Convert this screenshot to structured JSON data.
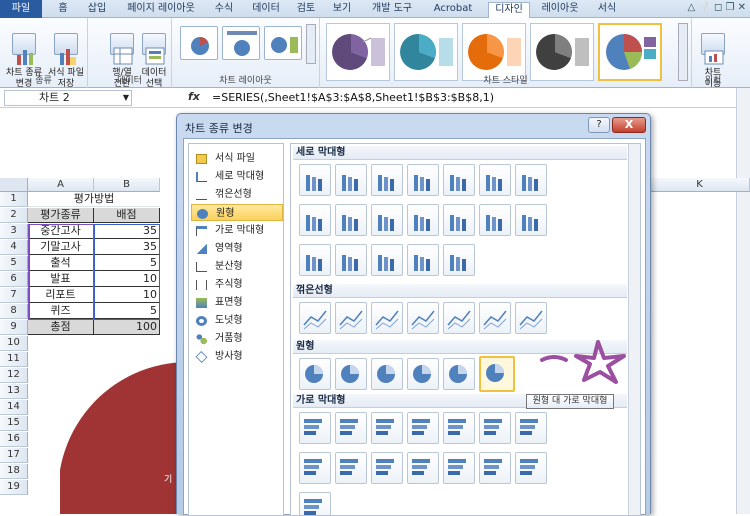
{
  "ribbon": {
    "tabs": [
      "파일",
      "홈",
      "삽입",
      "페이지 레이아웃",
      "수식",
      "데이터",
      "검토",
      "보기",
      "개발 도구",
      "Acrobat",
      "디자인",
      "레이아웃",
      "서식"
    ],
    "groups": {
      "type": {
        "label": "종류",
        "change_type": "차트 종류\n변경",
        "save_template": "서식 파일\n저장"
      },
      "data": {
        "label": "데이터",
        "switch": "행/열\n전환",
        "select": "데이터\n선택"
      },
      "layouts": {
        "label": "차트 레이아웃"
      },
      "styles": {
        "label": "차트 스타일"
      },
      "location": {
        "label": "위치",
        "move": "차트\n이동"
      }
    }
  },
  "formula_bar": {
    "name_box": "차트 2",
    "fx": "fx",
    "formula": "=SERIES(,Sheet1!$A$3:$A$8,Sheet1!$B$3:$B$8,1)"
  },
  "sheet": {
    "columns": [
      "A",
      "B",
      "K"
    ],
    "rows": [
      "1",
      "2",
      "3",
      "4",
      "5",
      "6",
      "7",
      "8",
      "9",
      "10",
      "11",
      "12",
      "13",
      "14",
      "15",
      "16",
      "17",
      "18",
      "19"
    ],
    "title": "평가방법",
    "header": [
      "평가종류",
      "배점"
    ],
    "data": [
      [
        "중간고사",
        "35"
      ],
      [
        "기말고사",
        "35"
      ],
      [
        "출석",
        "5"
      ],
      [
        "발표",
        "10"
      ],
      [
        "리포트",
        "10"
      ],
      [
        "퀴즈",
        "5"
      ]
    ],
    "total": [
      "총점",
      "100"
    ],
    "chart_text": "기"
  },
  "dialog": {
    "title": "차트 종류 변경",
    "help": "?",
    "close": "X",
    "types": [
      "서식 파일",
      "세로 막대형",
      "꺾은선형",
      "원형",
      "가로 막대형",
      "영역형",
      "분산형",
      "주식형",
      "표면형",
      "도넛형",
      "거품형",
      "방사형"
    ],
    "selected_type": "원형",
    "sections": [
      "세로 막대형",
      "꺾은선형",
      "원형",
      "가로 막대형"
    ],
    "tooltip": "원형 대 가로 막대형"
  },
  "colors": {
    "pie": "#a03434",
    "accent": "#f0c040",
    "annotation": "#9b4fa0"
  }
}
